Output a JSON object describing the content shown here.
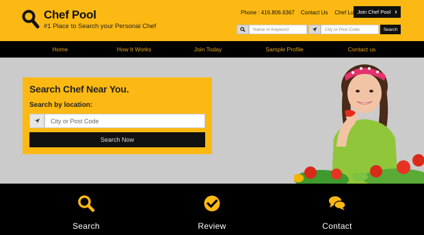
{
  "brand": {
    "name": "Chef Pool",
    "tagline": "#1 Place to Search your Personal Chef",
    "accent_color": "#fdb913",
    "dark_color": "#111111"
  },
  "top_links": {
    "phone": "Phone : 416.806.6367",
    "contact": "Contact Us",
    "chef_login": "Chef Login",
    "join_button": "Join Chef Pool"
  },
  "header_search": {
    "keyword_placeholder": "Name or Keyword",
    "location_placeholder": "City or Post Code",
    "button": "Search"
  },
  "nav": {
    "items": [
      {
        "label": "Home"
      },
      {
        "label": "How It Works"
      },
      {
        "label": "Join Today"
      },
      {
        "label": "Sample Profile"
      },
      {
        "label": "Contact us"
      }
    ]
  },
  "hero_search": {
    "title": "Search Chef Near You.",
    "label": "Search by location:",
    "placeholder": "City or Post Code",
    "button": "Search Now"
  },
  "features": [
    {
      "label": "Search",
      "icon": "search-icon"
    },
    {
      "label": "Review",
      "icon": "check-circle-icon"
    },
    {
      "label": "Contact",
      "icon": "chat-bubbles-icon"
    }
  ]
}
